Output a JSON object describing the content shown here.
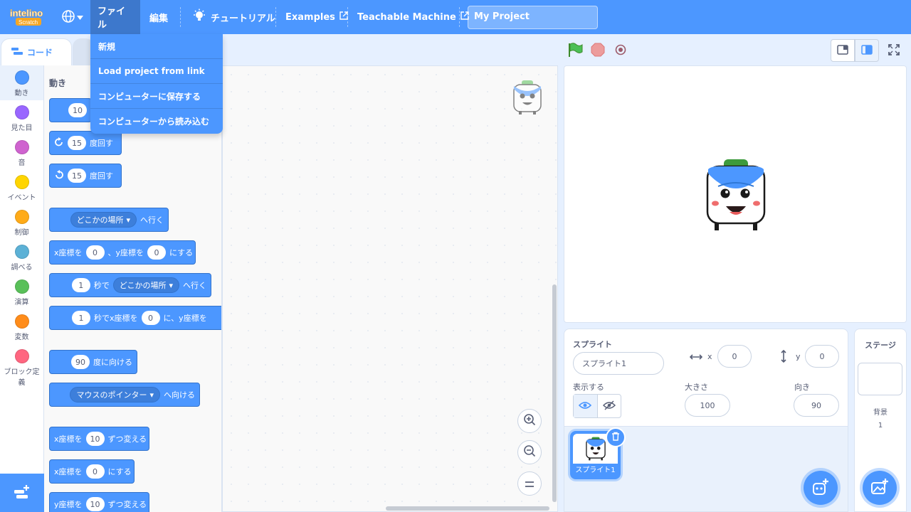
{
  "menubar": {
    "logo_text": "intelino",
    "logo_sub": "Scratch",
    "file_label": "ファイル",
    "edit_label": "編集",
    "tutorial_label": "チュートリアル",
    "examples_label": "Examples",
    "teachable_label": "Teachable Machine",
    "project_title": "My Project"
  },
  "file_menu": [
    "新規",
    "Load project from link",
    "コンピューターに保存する",
    "コンピューターから読み込む"
  ],
  "tabs": {
    "code_label": "コード"
  },
  "categories": [
    {
      "label": "動き",
      "color": "#4c97ff"
    },
    {
      "label": "見た目",
      "color": "#9966ff"
    },
    {
      "label": "音",
      "color": "#cf63cf"
    },
    {
      "label": "イベント",
      "color": "#ffd500"
    },
    {
      "label": "制御",
      "color": "#ffab19"
    },
    {
      "label": "調べる",
      "color": "#5cb1d6"
    },
    {
      "label": "演算",
      "color": "#59c059"
    },
    {
      "label": "変数",
      "color": "#ff8c1a"
    },
    {
      "label": "ブロック定義",
      "color": "#ff6680"
    }
  ],
  "palette": {
    "title": "動き",
    "b1_num": "10",
    "b2_num": "15",
    "b2_text": "度回す",
    "b3_num": "15",
    "b3_text": "度回す",
    "b4_drop": "どこかの場所",
    "b4_text": "へ行く",
    "b5_t1": "x座標を",
    "b5_n1": "0",
    "b5_t2": "、y座標を",
    "b5_n2": "0",
    "b5_t3": "にする",
    "b6_n1": "1",
    "b6_t1": "秒で",
    "b6_drop": "どこかの場所",
    "b6_t2": "へ行く",
    "b7_n1": "1",
    "b7_t1": "秒でx座標を",
    "b7_n2": "0",
    "b7_t2": "に、y座標を",
    "b8_num": "90",
    "b8_text": "度に向ける",
    "b9_drop": "マウスのポインター",
    "b9_text": "へ向ける",
    "b10_t1": "x座標を",
    "b10_num": "10",
    "b10_t2": "ずつ変える",
    "b11_t1": "x座標を",
    "b11_num": "0",
    "b11_t2": "にする",
    "b12_t1": "y座標を",
    "b12_num": "10",
    "b12_t2": "ずつ変える"
  },
  "sprite_info": {
    "heading": "スプライト",
    "name": "スプライト1",
    "x_label": "x",
    "x_value": "0",
    "y_label": "y",
    "y_value": "0",
    "show_label": "表示する",
    "size_label": "大きさ",
    "size_value": "100",
    "direction_label": "向き",
    "direction_value": "90"
  },
  "sprite_list": [
    {
      "name": "スプライト1"
    }
  ],
  "stage_panel": {
    "title": "ステージ",
    "backdrops_label": "背景",
    "backdrops_count": "1"
  },
  "colors": {
    "accent": "#4c97ff",
    "menu_active": "#3d78cc"
  }
}
